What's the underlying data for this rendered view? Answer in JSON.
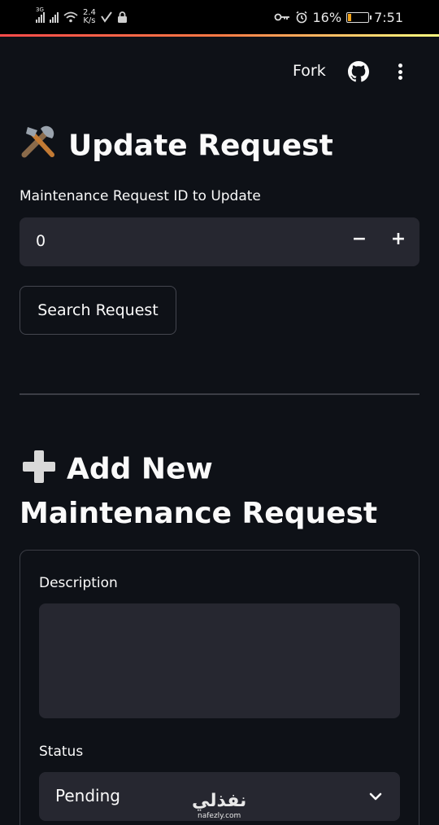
{
  "status_bar": {
    "network": "3G",
    "speed_value": "2.4",
    "speed_unit": "K/s",
    "battery": "16%",
    "time": "7:51",
    "battery_level": 0.16
  },
  "header": {
    "fork_label": "Fork",
    "github_icon": "github-icon",
    "menu_icon": "more-vertical-icon"
  },
  "update_section": {
    "title": "Update Request",
    "title_emoji": "🛠️",
    "id_label": "Maintenance Request ID to Update",
    "id_value": "0",
    "decrement_label": "−",
    "increment_label": "+",
    "search_button": "Search Request"
  },
  "add_section": {
    "title": "Add New Maintenance Request",
    "title_emoji": "➕",
    "description_label": "Description",
    "description_value": "",
    "status_label": "Status",
    "status_value": "Pending"
  },
  "watermark": {
    "arabic": "نفذلي",
    "latin": "nafezly.com"
  },
  "colors": {
    "background": "#0e1117",
    "input_bg": "#262730",
    "border": "#3b3d45",
    "text": "#fafafa",
    "accent": "#ff4b4b"
  }
}
